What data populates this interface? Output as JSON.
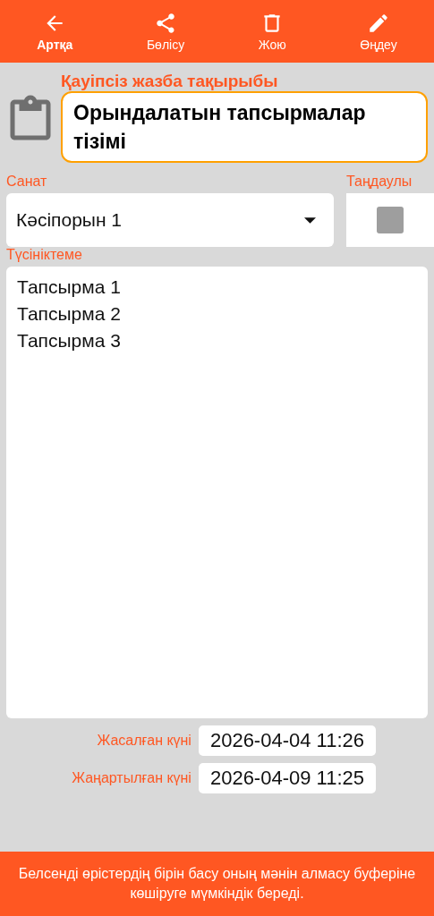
{
  "toolbar": [
    {
      "kind": "back",
      "label": "Артқа",
      "selected": true
    },
    {
      "kind": "share",
      "label": "Бөлісу",
      "selected": false
    },
    {
      "kind": "delete",
      "label": "Жою",
      "selected": false
    },
    {
      "kind": "edit",
      "label": "Өңдеу",
      "selected": false
    }
  ],
  "title_field": {
    "label": "Қауіпсіз жазба тақырыбы",
    "value": "Орындалатын тапсырмалар тізімі"
  },
  "category": {
    "label": "Санат",
    "value": "Кәсіпорын 1"
  },
  "favorite": {
    "label": "Таңдаулы",
    "checked": false
  },
  "comment": {
    "label": "Түсініктеме",
    "value": "Тапсырма 1\nТапсырма 2\nТапсырма 3"
  },
  "dates": [
    {
      "label": "Жасалған күні",
      "value": "2026-04-04 11:26"
    },
    {
      "label": "Жаңартылған күні",
      "value": "2026-04-09 11:25"
    }
  ],
  "footer": "Белсенді өрістердің бірін басу оның мәнін алмасу буферіне көшіруге мүмкіндік береді."
}
